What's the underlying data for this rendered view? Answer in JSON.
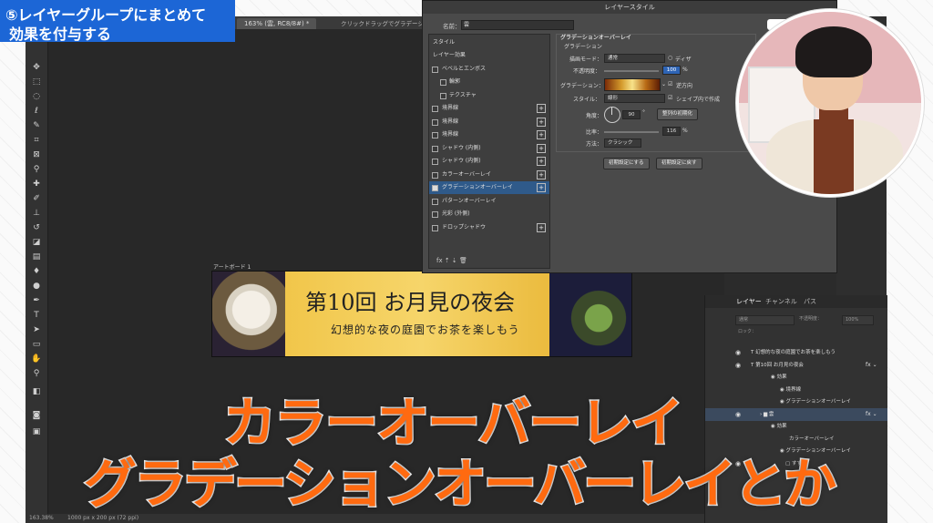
{
  "badge": {
    "line1": "⑤レイヤーグループにまとめて",
    "line2": "効果を付与する",
    "color": "#1c66d6"
  },
  "doc_tab": "163% (雲, RC8/8#) *",
  "hint_text": "クリックドラッグでグラデーシ...",
  "status": {
    "zoom": "163.38%",
    "size": "1000 px x 200 px (72 ppi)"
  },
  "artboard": {
    "label": "アートボード 1",
    "title": "第10回 お月見の夜会",
    "subtitle": "幻想的な夜の庭園でお茶を楽しもう"
  },
  "dialog": {
    "title": "レイヤースタイル",
    "name_label": "名前：",
    "name_value": "雲",
    "style_header": "スタイル",
    "items": [
      {
        "label": "レイヤー効果",
        "checkbox": false,
        "plus": false,
        "indent": false,
        "selected": false,
        "on": false
      },
      {
        "label": "ベベルとエンボス",
        "checkbox": true,
        "plus": false,
        "indent": false,
        "selected": false,
        "on": false
      },
      {
        "label": "輪郭",
        "checkbox": true,
        "plus": false,
        "indent": true,
        "selected": false,
        "on": false
      },
      {
        "label": "テクスチャ",
        "checkbox": true,
        "plus": false,
        "indent": true,
        "selected": false,
        "on": false
      },
      {
        "label": "境界線",
        "checkbox": true,
        "plus": true,
        "indent": false,
        "selected": false,
        "on": false
      },
      {
        "label": "境界線",
        "checkbox": true,
        "plus": true,
        "indent": false,
        "selected": false,
        "on": false
      },
      {
        "label": "境界線",
        "checkbox": true,
        "plus": true,
        "indent": false,
        "selected": false,
        "on": false
      },
      {
        "label": "シャドウ (内側)",
        "checkbox": true,
        "plus": true,
        "indent": false,
        "selected": false,
        "on": false
      },
      {
        "label": "シャドウ (内側)",
        "checkbox": true,
        "plus": true,
        "indent": false,
        "selected": false,
        "on": false
      },
      {
        "label": "カラーオーバーレイ",
        "checkbox": true,
        "plus": true,
        "indent": false,
        "selected": false,
        "on": false
      },
      {
        "label": "グラデーションオーバーレイ",
        "checkbox": true,
        "plus": true,
        "indent": false,
        "selected": true,
        "on": true
      },
      {
        "label": "パターンオーバーレイ",
        "checkbox": true,
        "plus": false,
        "indent": false,
        "selected": false,
        "on": false
      },
      {
        "label": "光彩 (外側)",
        "checkbox": true,
        "plus": false,
        "indent": false,
        "selected": false,
        "on": false
      },
      {
        "label": "ドロップシャドウ",
        "checkbox": true,
        "plus": true,
        "indent": false,
        "selected": false,
        "on": false
      }
    ],
    "footer": "fx  ⇡  ⇣       🗑",
    "section_title": "グラデーションオーバーレイ",
    "group_title": "グラデーション",
    "blend_label": "描画モード：",
    "blend_value": "通常",
    "dither_label": "ディザ",
    "opacity_label": "不透明度：",
    "opacity_value": "100",
    "opacity_unit": "%",
    "gradient_label": "グラデーション：",
    "reverse_label": "逆方向",
    "style_label": "スタイル：",
    "style_value": "線形",
    "align_label": "シェイプ内で作成",
    "angle_label": "角度：",
    "angle_value": "90",
    "angle_unit": "°",
    "reset_align_button": "整列の初期化",
    "scale_label": "比率：",
    "scale_value": "116",
    "scale_unit": "%",
    "method_label": "方法：",
    "method_value": "クラシック",
    "make_default_button": "初期設定にする",
    "reset_default_button": "初期設定に戻す"
  },
  "layers_panel": {
    "tabs": [
      "レイヤー",
      "チャンネル",
      "パス"
    ],
    "kind_value": "通常",
    "opacity_label": "不透明度：",
    "opacity_value": "100%",
    "lock_label": "ロック：",
    "rows": [
      {
        "text": "T  幻想的な夜の庭園でお茶を楽しもう",
        "indent": 50,
        "eye": true,
        "fx": false,
        "selected": false
      },
      {
        "text": "T  第10回 お月見の夜会",
        "indent": 50,
        "eye": true,
        "fx": true,
        "selected": false
      },
      {
        "text": "◉ 効果",
        "indent": 72,
        "eye": false,
        "fx": false,
        "selected": false
      },
      {
        "text": "◉ 境界線",
        "indent": 82,
        "eye": false,
        "fx": false,
        "selected": false
      },
      {
        "text": "◉ グラデーションオーバーレイ",
        "indent": 82,
        "eye": false,
        "fx": false,
        "selected": false
      },
      {
        "text": "›  ▆  雲",
        "indent": 60,
        "eye": true,
        "fx": true,
        "selected": true
      },
      {
        "text": "◉ 効果",
        "indent": 72,
        "eye": false,
        "fx": false,
        "selected": false
      },
      {
        "text": "カラーオーバーレイ",
        "indent": 92,
        "eye": false,
        "fx": false,
        "selected": false
      },
      {
        "text": "◉ グラデーションオーバーレイ",
        "indent": 82,
        "eye": false,
        "fx": false,
        "selected": false
      },
      {
        "text": "▢  すすき",
        "indent": 88,
        "eye": true,
        "fx": false,
        "selected": false
      }
    ]
  },
  "captions": {
    "line1": "カラーオーバーレイ",
    "line2": "グラデーションオーバーレイとか",
    "color": "#ff6a10"
  },
  "tools": [
    "move-icon",
    "artboard-icon",
    "marquee-icon",
    "lasso-icon",
    "quick-select-icon",
    "crop-icon",
    "frame-icon",
    "eyedropper-icon",
    "healing-icon",
    "brush-icon",
    "stamp-icon",
    "history-brush-icon",
    "eraser-icon",
    "gradient-icon",
    "blur-icon",
    "dodge-icon",
    "pen-icon",
    "type-icon",
    "path-select-icon",
    "shape-icon",
    "hand-icon",
    "zoom-icon"
  ]
}
